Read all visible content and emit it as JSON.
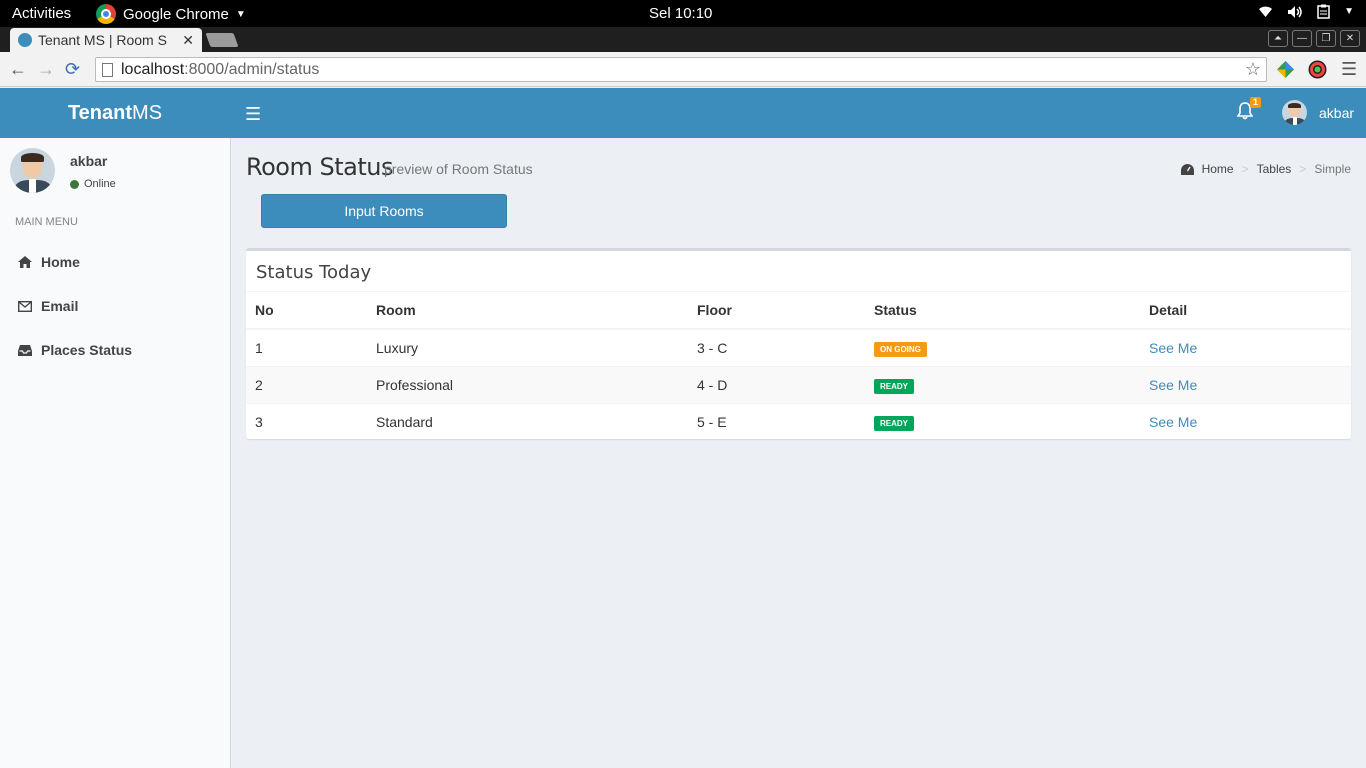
{
  "os": {
    "activities": "Activities",
    "app_name": "Google Chrome",
    "clock": "Sel 10:10"
  },
  "browser": {
    "tab_title": "Tenant MS | Room S",
    "url_host": "localhost",
    "url_path": ":8000/admin/status"
  },
  "app": {
    "logo_bold": "Tenant",
    "logo_light": "MS",
    "notification_count": "1",
    "user_name": "akbar",
    "brand_color": "#3c8dbc"
  },
  "sidebar": {
    "user_name": "akbar",
    "user_status": "Online",
    "menu_header": "MAIN MENU",
    "items": [
      {
        "label": "Home",
        "icon": "home-icon"
      },
      {
        "label": "Email",
        "icon": "envelope-icon"
      },
      {
        "label": "Places Status",
        "icon": "inbox-icon"
      }
    ]
  },
  "page": {
    "title": "Room Status",
    "subtitle": "preview of Room Status",
    "breadcrumb": [
      "Home",
      "Tables",
      "Simple"
    ],
    "input_button": "Input Rooms"
  },
  "table": {
    "title": "Status Today",
    "columns": [
      "No",
      "Room",
      "Floor",
      "Status",
      "Detail"
    ],
    "rows": [
      {
        "no": "1",
        "room": "Luxury",
        "floor": "3 - C",
        "status": "ON GOING",
        "status_color": "#f39c12",
        "detail": "See Me"
      },
      {
        "no": "2",
        "room": "Professional",
        "floor": "4 - D",
        "status": "READY",
        "status_color": "#00a65a",
        "detail": "See Me"
      },
      {
        "no": "3",
        "room": "Standard",
        "floor": "5 - E",
        "status": "READY",
        "status_color": "#00a65a",
        "detail": "See Me"
      }
    ]
  }
}
